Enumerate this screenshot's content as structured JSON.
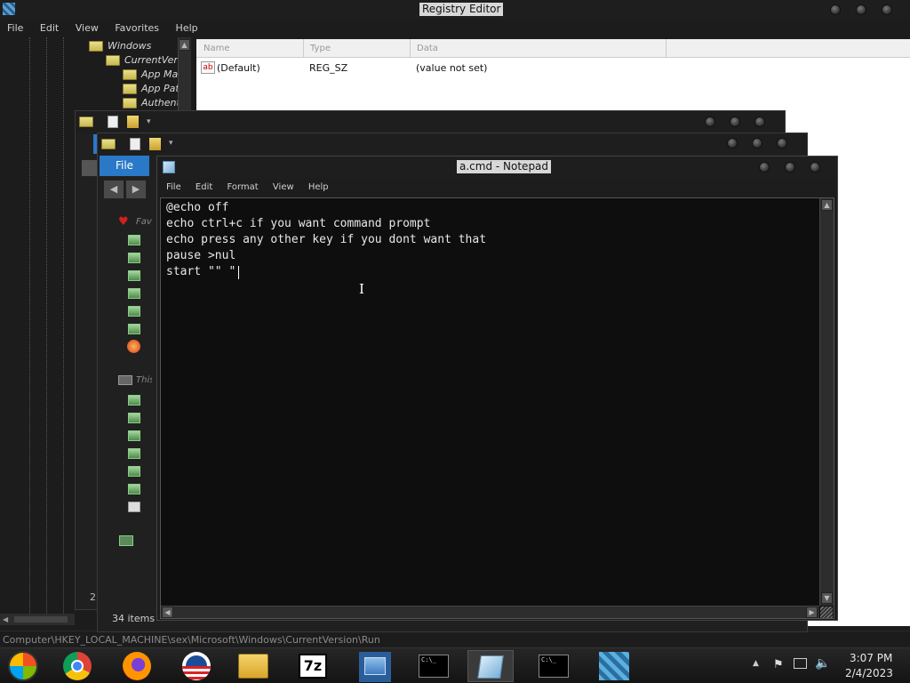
{
  "registry": {
    "title": "Registry Editor",
    "menu": [
      "File",
      "Edit",
      "View",
      "Favorites",
      "Help"
    ],
    "tree": [
      "Windows",
      "CurrentVers",
      "App Mar",
      "App Patl",
      "Authent"
    ],
    "columns": [
      "Name",
      "Type",
      "Data"
    ],
    "row": {
      "name": "(Default)",
      "type": "REG_SZ",
      "data": "(value not set)",
      "icon": "ab"
    },
    "status_path": "Computer\\HKEY_LOCAL_MACHINE\\sex\\Microsoft\\Windows\\CurrentVersion\\Run"
  },
  "explorer": {
    "file_tab": "File",
    "item_count": "34 items",
    "partial_num": "2",
    "partial_labels": [
      "Favo",
      "This"
    ]
  },
  "notepad": {
    "title": "a.cmd - Notepad",
    "menu": [
      "File",
      "Edit",
      "Format",
      "View",
      "Help"
    ],
    "lines": [
      "@echo off",
      "echo ctrl+c if you want command prompt",
      "echo press any other key if you dont want that",
      "pause >nul",
      "start \"\" \""
    ]
  },
  "taskbar": {
    "time": "3:07 PM",
    "date": "2/4/2023",
    "apps": [
      "start-button",
      "chrome-icon",
      "firefox-icon",
      "obama-logo-icon",
      "file-explorer-icon",
      "7zip-icon",
      "regedit-icon",
      "cmd-icon",
      "notepad-icon",
      "cmd-icon",
      "regedit-icon"
    ],
    "sevenzip_label": "7z",
    "cmd_label": "C:\\_"
  },
  "colors": {
    "accent": "#2a78c8",
    "bg": "#1c1c1c",
    "taskbar": "#1a1a1a"
  }
}
